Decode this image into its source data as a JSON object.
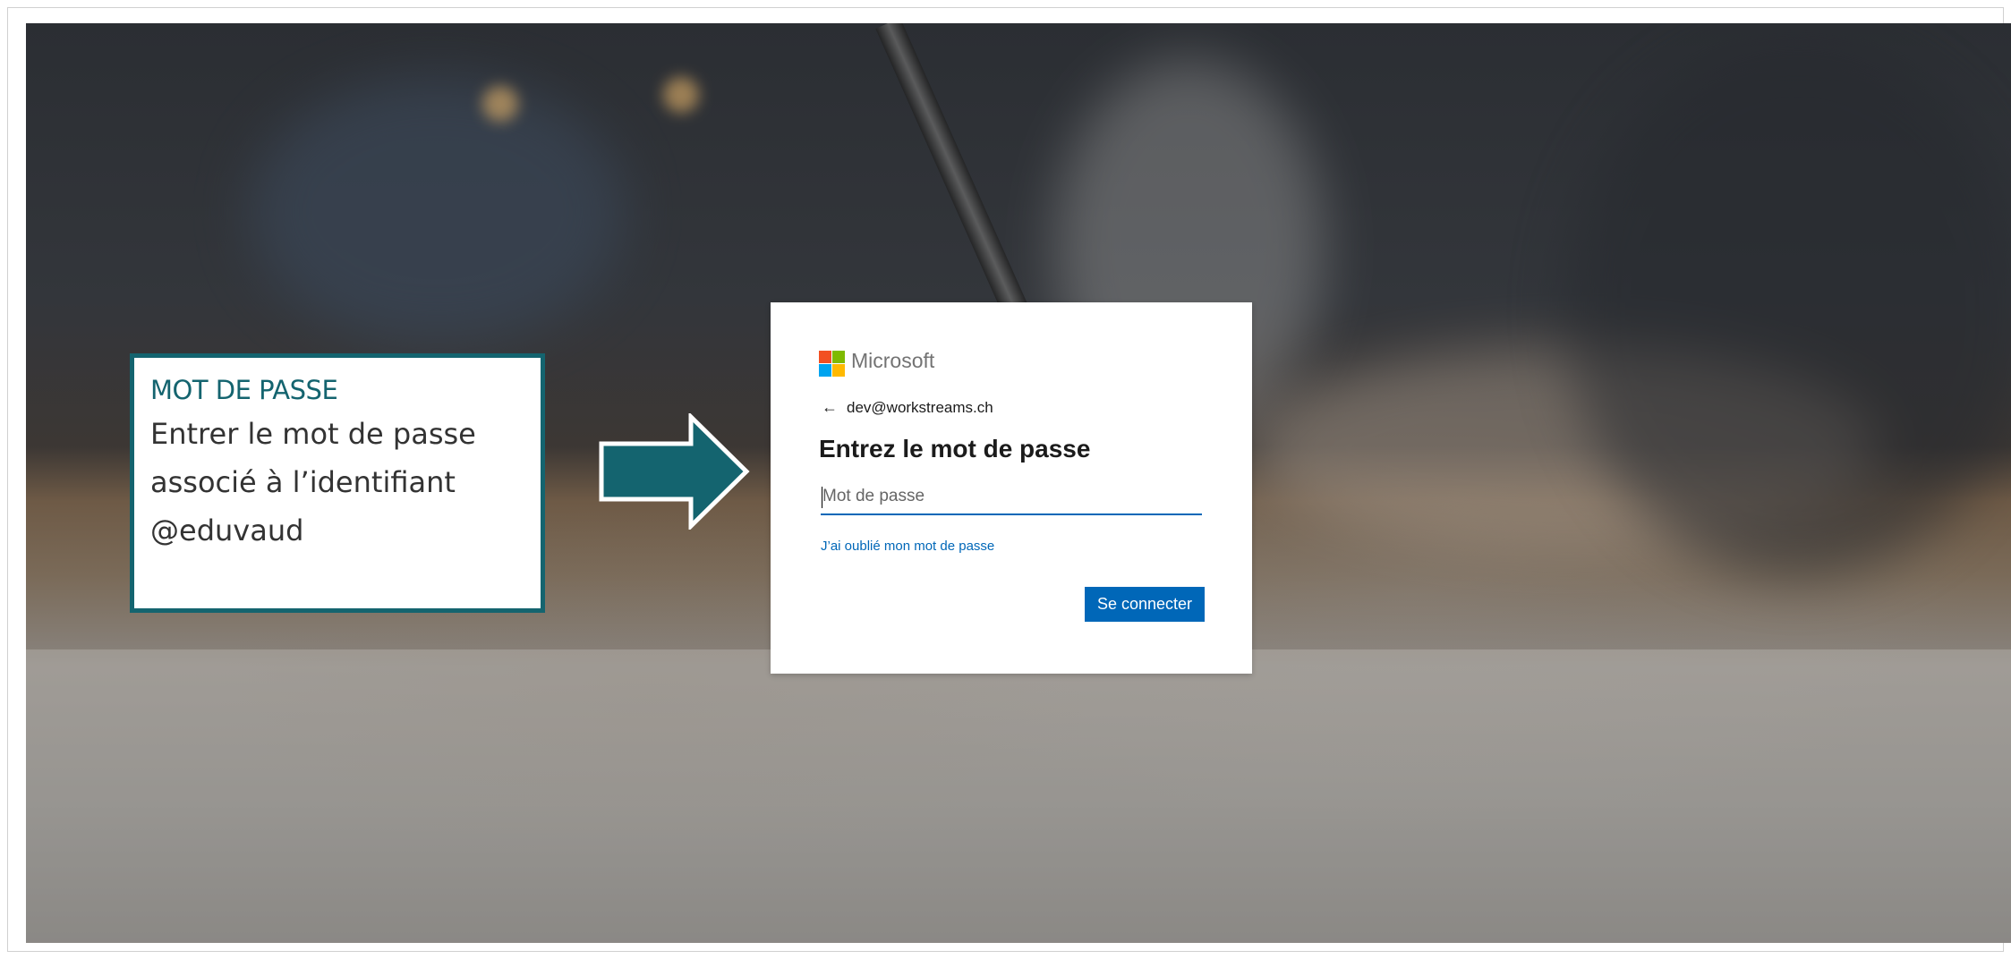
{
  "callout": {
    "title": "MOT DE PASSE",
    "line1": "Entrer le mot de passe",
    "line2": "associé à l’identifiant",
    "line3": "@eduvaud"
  },
  "signin_card": {
    "brand_name": "Microsoft",
    "brand_colors": [
      "#f25022",
      "#7fba00",
      "#00a4ef",
      "#ffb900"
    ],
    "back_icon": "arrow-left-icon",
    "account": "dev@workstreams.ch",
    "heading": "Entrez le mot de passe",
    "password_placeholder": "Mot de passe",
    "password_value": "",
    "forgot_link": "J’ai oublié mon mot de passe",
    "submit_label": "Se connecter",
    "accent_color": "#0067b8"
  },
  "colors": {
    "callout_border": "#14646f",
    "arrow_fill": "#14646f"
  }
}
